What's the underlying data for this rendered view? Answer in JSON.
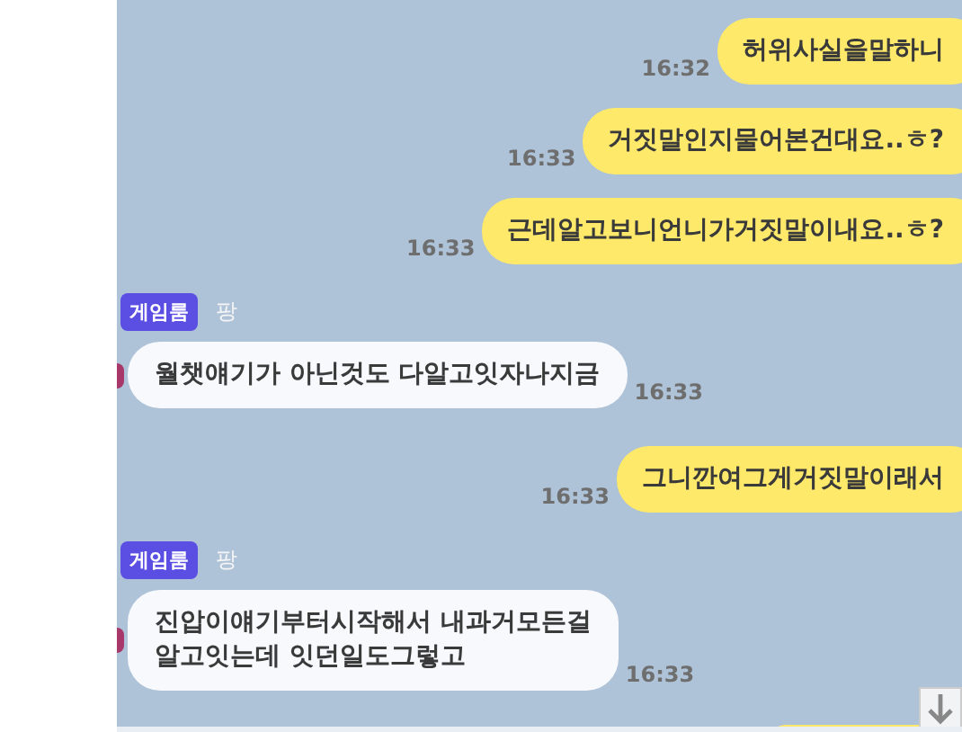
{
  "messages": [
    {
      "kind": "sent",
      "text": "허위사실을말하니",
      "time": "16:32"
    },
    {
      "kind": "sent",
      "text": "거짓말인지물어본건대요..ㅎ?",
      "time": "16:33"
    },
    {
      "kind": "sent",
      "text": "근데알고보니언니가거짓말이내요..ㅎ?",
      "time": "16:33"
    },
    {
      "kind": "received",
      "badge": "게임룸",
      "sender": "팡",
      "text": "월챗얘기가 아닌것도 다알고잇자나지금",
      "time": "16:33"
    },
    {
      "kind": "sent",
      "text": "그니깐여그게거짓말이래서",
      "time": "16:33"
    },
    {
      "kind": "received",
      "badge": "게임룸",
      "sender": "팡",
      "text": "진압이얘기부터시작해서 내과거모든걸\n알고잇는데 잇던일도그렇고",
      "time": "16:33"
    },
    {
      "kind": "sent_cut"
    }
  ]
}
